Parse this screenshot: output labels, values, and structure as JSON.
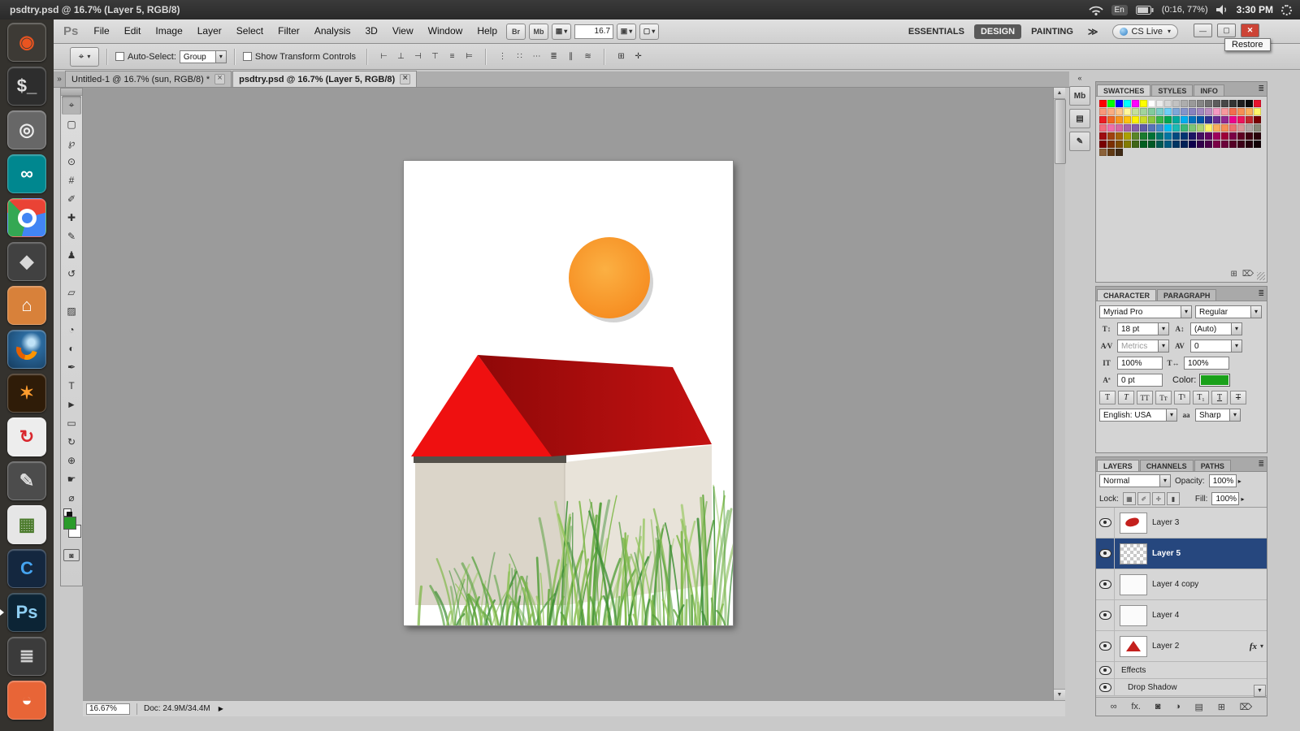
{
  "colors": {
    "selected_layer": "#26477e",
    "design_active_bg": "#595959",
    "close_red": "#cc4436",
    "fg_green": "#2a9b2a",
    "char_green": "#1aa11a",
    "canvas_bg": "#9b9b9b"
  },
  "ubuntu_bar": {
    "title": "psdtry.psd @ 16.7% (Layer 5, RGB/8)",
    "keyboard_indicator": "En",
    "battery_text": "(0:16, 77%)",
    "clock": "3:30 PM"
  },
  "launcher": {
    "items": [
      {
        "name": "launcher-dash-home",
        "glyph": "◉",
        "bg": "#3d3a35",
        "fg": "#e95420"
      },
      {
        "name": "launcher-terminal",
        "glyph": "$_",
        "bg": "#2d2d2d",
        "fg": "#e0e0e0"
      },
      {
        "name": "launcher-screenshot",
        "glyph": "◎",
        "bg": "#676767",
        "fg": "#ececec"
      },
      {
        "name": "launcher-arduino",
        "glyph": "∞",
        "bg": "#00878f",
        "fg": "#ffffff"
      },
      {
        "name": "launcher-chrome",
        "glyph": "",
        "bg": "",
        "kind": "chrome"
      },
      {
        "name": "launcher-inkscape",
        "glyph": "◆",
        "bg": "#414141",
        "fg": "#d8d8d8"
      },
      {
        "name": "launcher-files",
        "glyph": "⌂",
        "bg": "#d8813a",
        "fg": "#ffffff"
      },
      {
        "name": "launcher-firefox",
        "glyph": "",
        "bg": "",
        "kind": "firefox"
      },
      {
        "name": "launcher-flame",
        "glyph": "✶",
        "bg": "#2f1c08",
        "fg": "#ff9d2e"
      },
      {
        "name": "launcher-swirl",
        "glyph": "↻",
        "bg": "#ededed",
        "fg": "#d9272e"
      },
      {
        "name": "launcher-editor",
        "glyph": "✎",
        "bg": "#4c4c4c",
        "fg": "#dddddd"
      },
      {
        "name": "launcher-spreadsheet",
        "glyph": "▦",
        "bg": "#e6e6e6",
        "fg": "#4a7a2a"
      },
      {
        "name": "launcher-c-app",
        "glyph": "C",
        "bg": "#14273f",
        "fg": "#45a4f0"
      },
      {
        "name": "launcher-photoshop",
        "glyph": "Ps",
        "bg": "#0c2435",
        "fg": "#8ecef2",
        "running": true
      },
      {
        "name": "launcher-stack",
        "glyph": "≣",
        "bg": "#3b3b3b",
        "fg": "#cfcfcf"
      },
      {
        "name": "launcher-software",
        "glyph": "◒",
        "bg": "#e86537",
        "fg": "#ffffff"
      }
    ]
  },
  "menubar": {
    "logo": "Ps",
    "menus": [
      {
        "label": "File"
      },
      {
        "label": "Edit"
      },
      {
        "label": "Image"
      },
      {
        "label": "Layer"
      },
      {
        "label": "Select"
      },
      {
        "label": "Filter"
      },
      {
        "label": "Analysis"
      },
      {
        "label": "3D"
      },
      {
        "label": "View"
      },
      {
        "label": "Window"
      },
      {
        "label": "Help"
      }
    ],
    "bridge_btn": "Br",
    "minibridge_btn": "Mb",
    "view_extras_icon": "▦",
    "zoom_value": "16.7",
    "arrange_icon": "▣",
    "screen_icon": "▢",
    "workspaces": [
      {
        "label": "ESSENTIALS"
      },
      {
        "label": "DESIGN",
        "active": true
      },
      {
        "label": "PAINTING"
      }
    ],
    "workspace_overflow": "≫",
    "cs_live": "CS Live",
    "window_buttons": {
      "minimize": "—",
      "restore": "▢",
      "close": "✕"
    },
    "tooltip": "Restore"
  },
  "options_bar": {
    "tool_icon": "⌖",
    "auto_select_label": "Auto-Select:",
    "auto_select_value": "Group",
    "show_transform_label": "Show Transform Controls",
    "align_icons": [
      {
        "name": "align-left-edges-icon",
        "glyph": "⊢"
      },
      {
        "name": "align-h-centers-icon",
        "glyph": "⊥"
      },
      {
        "name": "align-right-edges-icon",
        "glyph": "⊣"
      },
      {
        "name": "align-top-edges-icon",
        "glyph": "⊤"
      },
      {
        "name": "align-v-centers-icon",
        "glyph": "≡"
      },
      {
        "name": "align-bottom-edges-icon",
        "glyph": "⊨"
      }
    ],
    "distribute_icons": [
      {
        "name": "distribute-top-icon",
        "glyph": "⋮"
      },
      {
        "name": "distribute-v-centers-icon",
        "glyph": "∷"
      },
      {
        "name": "distribute-bottom-icon",
        "glyph": "⋯"
      },
      {
        "name": "distribute-left-icon",
        "glyph": "≣"
      },
      {
        "name": "distribute-h-centers-icon",
        "glyph": "∥"
      },
      {
        "name": "distribute-right-icon",
        "glyph": "≋"
      }
    ],
    "extra_icons": [
      {
        "name": "auto-align-layers-icon",
        "glyph": "⊞"
      },
      {
        "name": "3d-axis-icon",
        "glyph": "✛"
      }
    ]
  },
  "document_tabs": [
    {
      "label": "Untitled-1 @ 16.7% (sun, RGB/8) *"
    },
    {
      "label": "psdtry.psd @ 16.7% (Layer 5, RGB/8)",
      "active": true
    }
  ],
  "tools": [
    {
      "name": "move-tool",
      "glyph": "⌖",
      "selected": true
    },
    {
      "name": "marquee-tool",
      "glyph": "▢"
    },
    {
      "name": "lasso-tool",
      "glyph": "℘"
    },
    {
      "name": "quick-selection-tool",
      "glyph": "⊙"
    },
    {
      "name": "crop-tool",
      "glyph": "#"
    },
    {
      "name": "eyedropper-tool",
      "glyph": "✐"
    },
    {
      "name": "healing-brush-tool",
      "glyph": "✚"
    },
    {
      "name": "brush-tool",
      "glyph": "✎"
    },
    {
      "name": "clone-stamp-tool",
      "glyph": "♟"
    },
    {
      "name": "history-brush-tool",
      "glyph": "↺"
    },
    {
      "name": "eraser-tool",
      "glyph": "▱"
    },
    {
      "name": "gradient-tool",
      "glyph": "▨"
    },
    {
      "name": "blur-tool",
      "glyph": "◔"
    },
    {
      "name": "dodge-tool",
      "glyph": "◐"
    },
    {
      "name": "pen-tool",
      "glyph": "✒"
    },
    {
      "name": "type-tool",
      "glyph": "T"
    },
    {
      "name": "path-selection-tool",
      "glyph": "►"
    },
    {
      "name": "shape-tool",
      "glyph": "▭"
    },
    {
      "name": "3d-rotate-tool",
      "glyph": "↻"
    },
    {
      "name": "3d-pan-tool",
      "glyph": "⊕"
    },
    {
      "name": "hand-tool",
      "glyph": "☛"
    },
    {
      "name": "zoom-tool",
      "glyph": "⌀"
    }
  ],
  "tool_extras": {
    "quick_mask_icon": "◙"
  },
  "canvas": {
    "sun_center": "#fbb043",
    "sun_edge": "#f68b1f",
    "sun_shadow": "#a8a8a8",
    "roof_front": "#ef1010",
    "roof_side_dark": "#8f0808",
    "roof_side_light": "#c41212",
    "eave": "#54514a",
    "wall_left": "#dbd5c9",
    "wall_right": "#e8e3d9",
    "wall_edge": "#c2bbae",
    "grass_colors": [
      "#7fb84a",
      "#55a03c",
      "#93c65b",
      "#3e8f35",
      "#6aab45"
    ]
  },
  "panels": {
    "swatches": {
      "tabs": [
        {
          "label": "SWATCHES",
          "active": true
        },
        {
          "label": "STYLES"
        },
        {
          "label": "INFO"
        }
      ],
      "colors": [
        "#ff0000",
        "#00ff00",
        "#0000ff",
        "#00ffff",
        "#ff00ff",
        "#ffff00",
        "#ffffff",
        "#ebebeb",
        "#d6d6d6",
        "#c2c2c2",
        "#adadad",
        "#999999",
        "#858585",
        "#707070",
        "#5c5c5c",
        "#474747",
        "#333333",
        "#1e1e1e",
        "#0a0a0a",
        "#e8112d",
        "#f7977a",
        "#f9ad81",
        "#fdc68a",
        "#fff79a",
        "#c4df9b",
        "#a2d39c",
        "#82ca9d",
        "#7bcdc8",
        "#6ecff6",
        "#7ea7d8",
        "#8493ca",
        "#8882be",
        "#a187be",
        "#bc8dbf",
        "#f49ac2",
        "#f6989d",
        "#f26c4f",
        "#f68e55",
        "#fbaf5c",
        "#fff568",
        "#ed1c24",
        "#f26522",
        "#f7941d",
        "#ffc20e",
        "#fff200",
        "#cbdb2a",
        "#8dc63f",
        "#39b54a",
        "#00a651",
        "#00a99d",
        "#00aeef",
        "#0072bc",
        "#0054a6",
        "#2e3192",
        "#662d91",
        "#92278f",
        "#ec008c",
        "#ed145b",
        "#c1272d",
        "#790000",
        "#f26d7d",
        "#f06eaa",
        "#d668a3",
        "#a763a9",
        "#855fa8",
        "#605ca8",
        "#5674b9",
        "#448ccb",
        "#00bff3",
        "#1cbbb4",
        "#3cb878",
        "#7cc576",
        "#acd373",
        "#fff468",
        "#fbaf5d",
        "#f68e56",
        "#ed7171",
        "#d99898",
        "#b0a6a4",
        "#8a8a7a",
        "#9e0b0f",
        "#a0410d",
        "#a36209",
        "#aba000",
        "#598527",
        "#1a7b30",
        "#007236",
        "#00746b",
        "#0076a3",
        "#004a80",
        "#003471",
        "#1b1464",
        "#440e62",
        "#630460",
        "#9e005d",
        "#9e0039",
        "#7b0046",
        "#5e0022",
        "#3f0011",
        "#2a000b",
        "#790000",
        "#7b2e00",
        "#7d4900",
        "#827b00",
        "#406618",
        "#005e20",
        "#005826",
        "#005952",
        "#005b7f",
        "#003663",
        "#002157",
        "#0d004c",
        "#32004b",
        "#4b0049",
        "#7b0046",
        "#6b003a",
        "#550026",
        "#3d0018",
        "#26000c",
        "#120005",
        "#8c6239",
        "#603913",
        "#3f2a16"
      ]
    },
    "character": {
      "tabs": [
        {
          "label": "CHARACTER",
          "active": true
        },
        {
          "label": "PARAGRAPH"
        }
      ],
      "font_family": "Myriad Pro",
      "font_style": "Regular",
      "size": "18 pt",
      "leading": "(Auto)",
      "kerning": "Metrics",
      "tracking": "0",
      "vertical_scale": "100%",
      "horizontal_scale": "100%",
      "baseline": "0 pt",
      "color_label": "Color:",
      "language": "English: USA",
      "anti_alias": "Sharp",
      "icons": {
        "size": "T↕",
        "leading": "A↕",
        "kerning": "A⁄V",
        "tracking": "AV",
        "v_scale": "IT",
        "h_scale": "T↔",
        "baseline": "Aª",
        "anti_alias": "aa"
      },
      "style_buttons": [
        {
          "name": "faux-bold-button",
          "glyph": "T",
          "variant": "bold"
        },
        {
          "name": "faux-italic-button",
          "glyph": "T",
          "variant": "italic"
        },
        {
          "name": "all-caps-button",
          "glyph": "TT",
          "variant": "caps"
        },
        {
          "name": "small-caps-button",
          "glyph": "Tᴛ",
          "variant": "smallcaps"
        },
        {
          "name": "superscript-button",
          "glyph": "T¹",
          "variant": "sup"
        },
        {
          "name": "subscript-button",
          "glyph": "T₁",
          "variant": "sub"
        },
        {
          "name": "underline-button",
          "glyph": "T",
          "variant": "underline"
        },
        {
          "name": "strikethrough-button",
          "glyph": "T",
          "variant": "strike"
        }
      ]
    },
    "layers": {
      "tabs": [
        {
          "label": "LAYERS",
          "active": true
        },
        {
          "label": "CHANNELS"
        },
        {
          "label": "PATHS"
        }
      ],
      "blend_mode": "Normal",
      "opacity_label": "Opacity:",
      "opacity_value": "100%",
      "lock_label": "Lock:",
      "fill_label": "Fill:",
      "fill_value": "100%",
      "fx_badge": "fx",
      "lock_icons": [
        {
          "name": "lock-transparency-icon",
          "glyph": "▦"
        },
        {
          "name": "lock-pixels-icon",
          "glyph": "✐"
        },
        {
          "name": "lock-position-icon",
          "glyph": "✛"
        },
        {
          "name": "lock-all-icon",
          "glyph": "▮"
        }
      ],
      "items": [
        {
          "name": "Layer 3",
          "thumb": "smudge"
        },
        {
          "name": "Layer 5",
          "thumb": "checker",
          "selected": true
        },
        {
          "name": "Layer 4 copy",
          "thumb": "plain"
        },
        {
          "name": "Layer 4",
          "thumb": "plain"
        },
        {
          "name": "Layer 2",
          "thumb": "triangle",
          "fx": true
        },
        {
          "name": "Effects",
          "sub": "effects"
        },
        {
          "name": "Drop Shadow",
          "sub": "shadow"
        }
      ],
      "bottom_icons": [
        {
          "name": "link-layers-icon",
          "glyph": "∞"
        },
        {
          "name": "layer-style-icon",
          "glyph": "fx."
        },
        {
          "name": "layer-mask-icon",
          "glyph": "◙"
        },
        {
          "name": "adjustment-layer-icon",
          "glyph": "◑"
        },
        {
          "name": "layer-group-icon",
          "glyph": "▤"
        },
        {
          "name": "new-layer-icon",
          "glyph": "⊞"
        },
        {
          "name": "delete-layer-icon",
          "glyph": "⌦"
        }
      ]
    }
  },
  "rail": [
    {
      "name": "mini-bridge-panel-icon",
      "label": "Mb"
    },
    {
      "name": "history-panel-icon",
      "label": "▤"
    },
    {
      "name": "notes-panel-icon",
      "label": "✎"
    }
  ],
  "statusbar": {
    "zoom": "16.67%",
    "doc_sizes": "Doc: 24.9M/34.4M"
  },
  "icons": {
    "overflow": "»",
    "collapse": "«",
    "panel_menu": "≣",
    "tab_close": "×",
    "status_arrow": "▶",
    "scroll_up": "▲",
    "scroll_down": "▼",
    "spin_arrow": "▸"
  }
}
